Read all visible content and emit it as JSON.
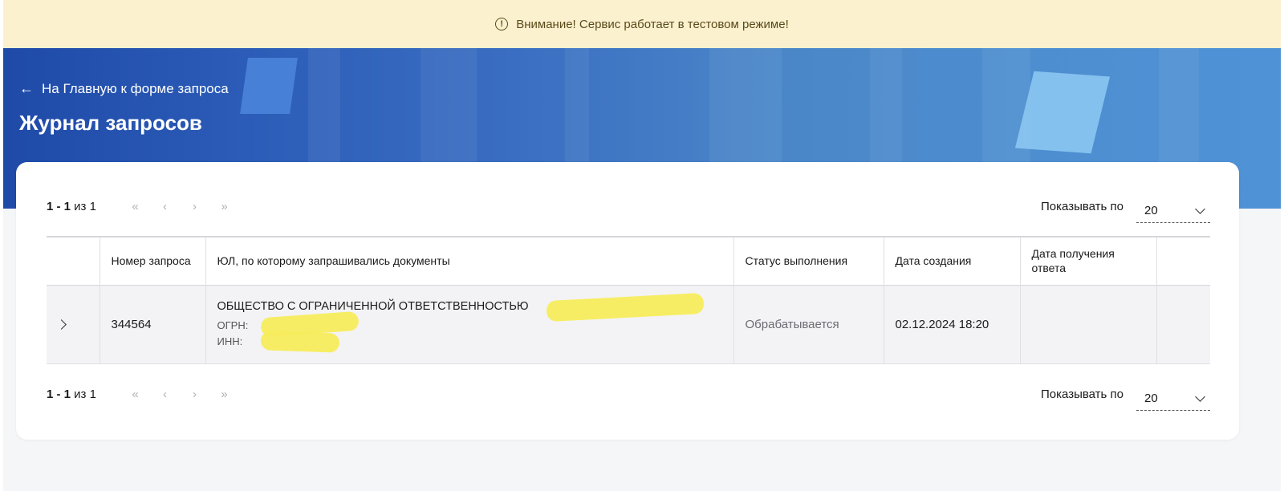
{
  "banner": {
    "icon": "exclamation-circle-icon",
    "text": "Внимание! Сервис работает в тестовом режиме!"
  },
  "header": {
    "back_icon": "arrow-left-icon",
    "back_label": "На Главную к форме запроса",
    "title": "Журнал запросов"
  },
  "pagination_top": {
    "range_bold": "1 - 1",
    "range_rest": " из 1",
    "first": "«",
    "prev": "‹",
    "next": "›",
    "last": "»",
    "per_page_label": "Показывать по",
    "per_page_value": "20"
  },
  "pagination_bottom": {
    "range_bold": "1 - 1",
    "range_rest": " из 1",
    "first": "«",
    "prev": "‹",
    "next": "›",
    "last": "»",
    "per_page_label": "Показывать по",
    "per_page_value": "20"
  },
  "table": {
    "columns": [
      "Номер запроса",
      "ЮЛ, по которому запрашивались документы",
      "Статус выполнения",
      "Дата создания",
      "Дата получения ответа"
    ],
    "rows": [
      {
        "number": "344564",
        "org_name": "ОБЩЕСТВО С ОГРАНИЧЕННОЙ ОТВЕТСТВЕННОСТЬЮ",
        "ogrn_label": "ОГРН:",
        "inn_label": "ИНН:",
        "status": "Обрабатывается",
        "created": "02.12.2024 18:20",
        "received": ""
      }
    ]
  },
  "colors": {
    "banner_bg": "#fbf1cf",
    "hero": "#2c5db8",
    "redaction": "#f7ec5c"
  }
}
